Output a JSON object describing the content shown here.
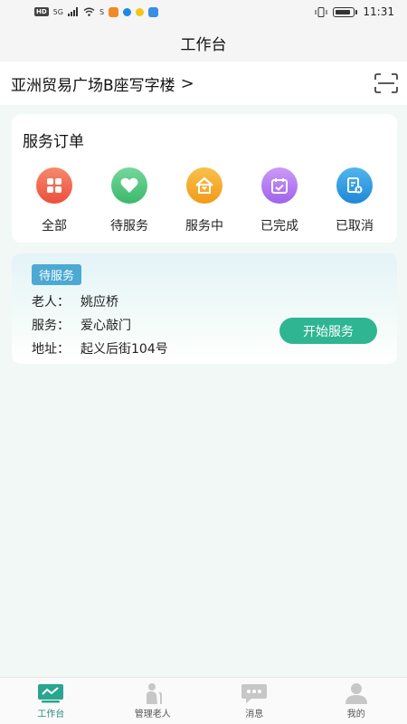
{
  "status_bar": {
    "left_chip": "HD",
    "signal": "5G",
    "time": "11:31"
  },
  "header": {
    "title": "工作台"
  },
  "location": {
    "name": "亚洲贸易广场B座写字楼",
    "chevron": ">",
    "scan_icon": "scan-icon"
  },
  "orders": {
    "title": "服务订单",
    "items": [
      {
        "label": "全部",
        "icon": "grid-icon",
        "color": "#f0644a"
      },
      {
        "label": "待服务",
        "icon": "heart-icon",
        "color": "#4cc47a"
      },
      {
        "label": "服务中",
        "icon": "home-icon",
        "color": "#f5a623"
      },
      {
        "label": "已完成",
        "icon": "calendar-check-icon",
        "color": "#b57cf0"
      },
      {
        "label": "已取消",
        "icon": "cancel-doc-icon",
        "color": "#2f9be0"
      }
    ]
  },
  "service_card": {
    "status": "待服务",
    "elder_label": "老人：",
    "elder_value": "姚应桥",
    "service_label": "服务：",
    "service_value": "爱心敲门",
    "address_label": "地址：",
    "address_value": "起义后街104号",
    "action_label": "开始服务",
    "accent": "#2fb592"
  },
  "bottom_nav": {
    "items": [
      {
        "label": "工作台",
        "icon": "workbench-icon",
        "active": true
      },
      {
        "label": "管理老人",
        "icon": "elderly-icon",
        "active": false
      },
      {
        "label": "消息",
        "icon": "message-icon",
        "active": false
      },
      {
        "label": "我的",
        "icon": "profile-icon",
        "active": false
      }
    ]
  }
}
